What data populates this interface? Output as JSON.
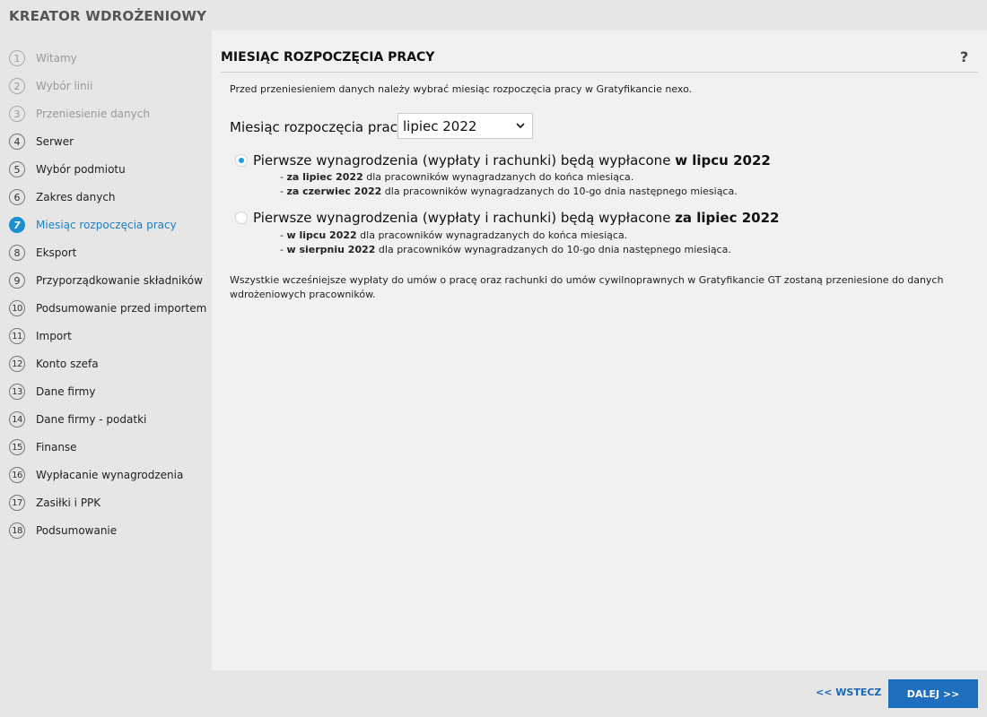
{
  "app": {
    "title": "KREATOR WDROŻENIOWY"
  },
  "steps": [
    {
      "num": "1",
      "label": "Witamy",
      "state": "done"
    },
    {
      "num": "2",
      "label": "Wybór linii",
      "state": "done"
    },
    {
      "num": "3",
      "label": "Przeniesienie danych",
      "state": "done"
    },
    {
      "num": "4",
      "label": "Serwer",
      "state": "todo"
    },
    {
      "num": "5",
      "label": "Wybór podmiotu",
      "state": "todo"
    },
    {
      "num": "6",
      "label": "Zakres danych",
      "state": "todo"
    },
    {
      "num": "7",
      "label": "Miesiąc rozpoczęcia pracy",
      "state": "active"
    },
    {
      "num": "8",
      "label": "Eksport",
      "state": "todo"
    },
    {
      "num": "9",
      "label": "Przyporządkowanie składników",
      "state": "todo"
    },
    {
      "num": "10",
      "label": "Podsumowanie przed importem",
      "state": "todo"
    },
    {
      "num": "11",
      "label": "Import",
      "state": "todo"
    },
    {
      "num": "12",
      "label": "Konto szefa",
      "state": "todo"
    },
    {
      "num": "13",
      "label": "Dane firmy",
      "state": "todo"
    },
    {
      "num": "14",
      "label": "Dane firmy - podatki",
      "state": "todo"
    },
    {
      "num": "15",
      "label": "Finanse",
      "state": "todo"
    },
    {
      "num": "16",
      "label": "Wypłacanie wynagrodzenia",
      "state": "todo"
    },
    {
      "num": "17",
      "label": "Zasiłki i PPK",
      "state": "todo"
    },
    {
      "num": "18",
      "label": "Podsumowanie",
      "state": "todo"
    }
  ],
  "main": {
    "title": "MIESIĄC ROZPOCZĘCIA PRACY",
    "help": "?",
    "intro": "Przed przeniesieniem danych należy wybrać miesiąc rozpoczęcia pracy w Gratyfikancie nexo.",
    "month_label": "Miesiąc rozpoczęcia pracy:",
    "month_value": "lipiec 2022",
    "option1": {
      "text": "Pierwsze wynagrodzenia (wypłaty i rachunki) będą wypłacone ",
      "bold": "w lipcu 2022",
      "selected": true,
      "sub1_pre": "- ",
      "sub1_bold": "za lipiec 2022",
      "sub1_rest": " dla pracowników wynagradzanych do końca miesiąca.",
      "sub2_pre": "- ",
      "sub2_bold": "za czerwiec 2022",
      "sub2_rest": " dla pracowników wynagradzanych do 10-go dnia następnego miesiąca."
    },
    "option2": {
      "text": "Pierwsze wynagrodzenia (wypłaty i rachunki) będą wypłacone ",
      "bold": "za lipiec 2022",
      "selected": false,
      "sub1_pre": "- ",
      "sub1_bold": "w lipcu 2022",
      "sub1_rest": " dla pracowników wynagradzanych do końca miesiąca.",
      "sub2_pre": "- ",
      "sub2_bold": "w sierpniu 2022",
      "sub2_rest": " dla pracowników wynagradzanych do 10-go dnia następnego miesiąca."
    },
    "note": "Wszystkie wcześniejsze wypłaty do umów o pracę oraz rachunki do umów cywilnoprawnych w Gratyfikancie GT zostaną przeniesione do danych wdrożeniowych pracowników."
  },
  "footer": {
    "back_label": "<< WSTECZ",
    "next_label": "DALEJ >>"
  },
  "icons": {
    "select": "chevron-down-icon",
    "help": "help-icon"
  },
  "colors": {
    "accent": "#1b8fd2",
    "primary_button": "#1f6fbf",
    "link": "#1a66b3"
  }
}
